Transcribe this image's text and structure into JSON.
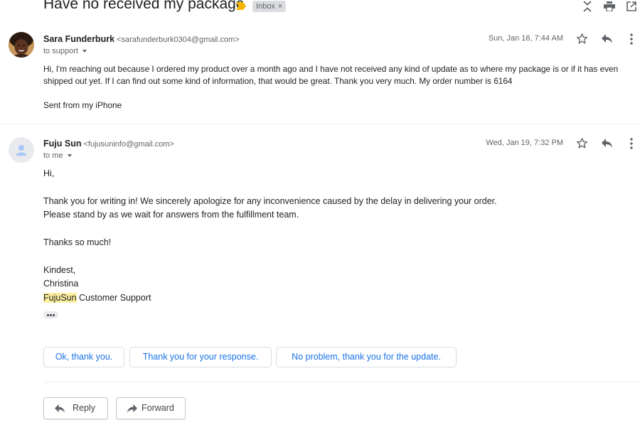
{
  "subject": {
    "title": "Have no received my package",
    "label": "Inbox",
    "label_remove": "×"
  },
  "messages": [
    {
      "sender_name": "Sara Funderburk",
      "sender_email": "<sarafunderburk0304@gmail.com>",
      "recipient": "to support",
      "date": "Sun, Jan 16, 7:44 AM",
      "body": [
        "Hi, I'm reaching out because I ordered my product over a month ago and I have not received any kind of update as to where my package is or if it has even shipped out yet. If I can find out some kind of information, that would be great. Thank you very much. My order number is 6164"
      ],
      "signature": "Sent from my iPhone"
    },
    {
      "sender_name": "Fuju Sun",
      "sender_email": "<fujusuninfo@gmail.com>",
      "recipient": "to me",
      "date": "Wed, Jan 19, 7:32 PM",
      "greeting": "Hi,",
      "line1": "Thank you for writing in! We sincerely apologize for any inconvenience caused by the delay in delivering your order.",
      "line2": "Please stand by as we wait for answers from the fulfillment team.",
      "thanks": "Thanks so much!",
      "closing": "Kindest,",
      "agent": "Christina",
      "brand": "FujuSun",
      "team": " Customer Support"
    }
  ],
  "smart_replies": [
    "Ok, thank you.",
    "Thank you for your response.",
    "No problem, thank you for the update."
  ],
  "actions": {
    "reply": "Reply",
    "forward": "Forward"
  },
  "colors": {
    "accent": "#1a73e8",
    "highlight": "#fcefa0",
    "importance": "#f4b400"
  }
}
